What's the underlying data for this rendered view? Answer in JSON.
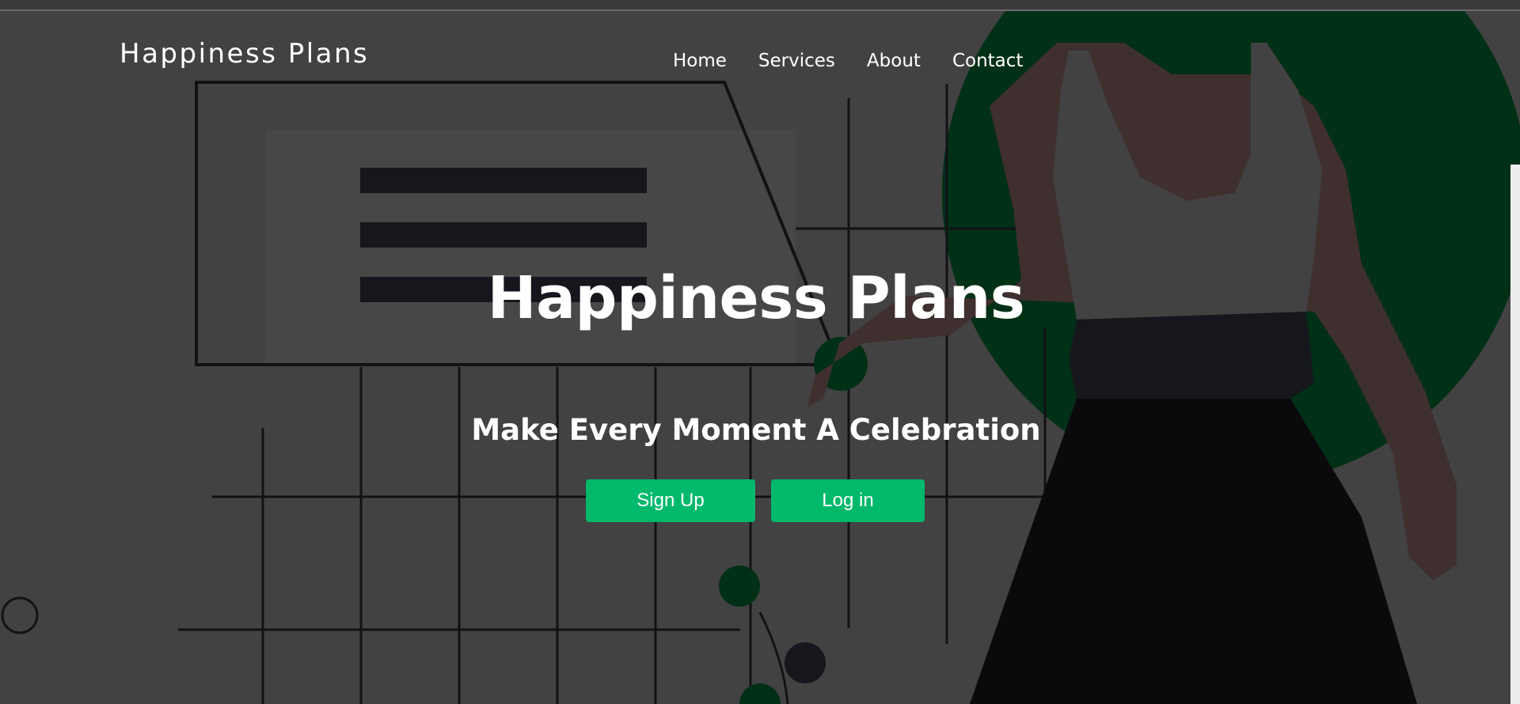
{
  "brand": {
    "name": "Happiness Plans"
  },
  "nav": {
    "items": [
      {
        "label": "Home"
      },
      {
        "label": "Services"
      },
      {
        "label": "About"
      },
      {
        "label": "Contact"
      }
    ]
  },
  "hero": {
    "title": "Happiness Plans",
    "subtitle": "Make Every Moment A Celebration",
    "buttons": {
      "signup_label": "Sign Up",
      "login_label": "Log in"
    }
  },
  "colors": {
    "background": "#424242",
    "accent_green": "#00b96b",
    "illustration_green": "#003015",
    "text": "#ffffff"
  }
}
